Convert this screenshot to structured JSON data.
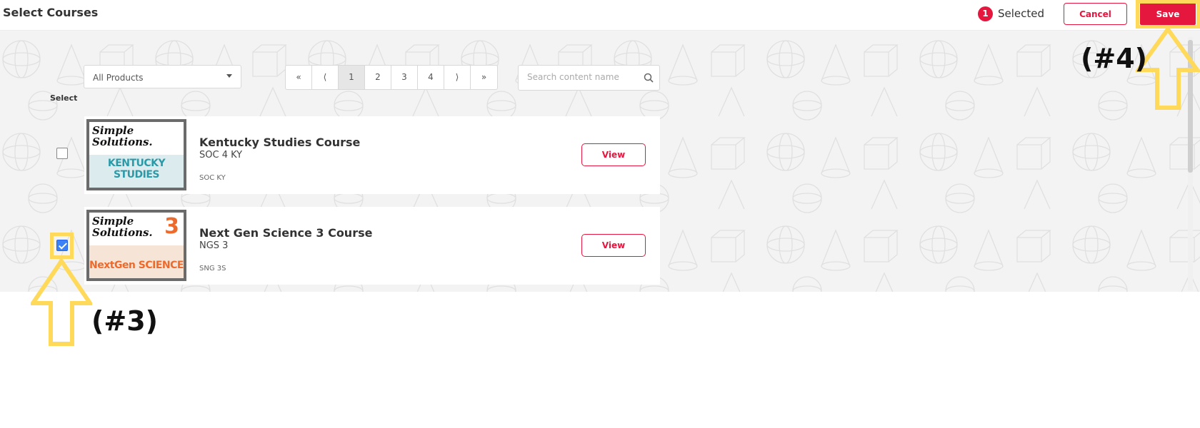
{
  "header": {
    "title": "Select Courses",
    "selected_count": "1",
    "selected_label": "Selected",
    "cancel_label": "Cancel",
    "save_label": "Save"
  },
  "filters": {
    "product_filter": "All Products",
    "pagination": [
      "«",
      "⟨",
      "1",
      "2",
      "3",
      "4",
      "⟩",
      "»"
    ],
    "current_page": "1",
    "search_placeholder": "Search content name"
  },
  "list": {
    "select_header": "Select",
    "courses": [
      {
        "title": "Kentucky Studies Course",
        "code": "SOC 4 KY",
        "subcode": "SOC KY",
        "view_label": "View",
        "checked": false,
        "thumb_brand": "Simple Solutions.",
        "thumb_title": "KENTUCKY STUDIES",
        "thumb_color": "#2a9aa8"
      },
      {
        "title": "Next Gen Science 3 Course",
        "code": "NGS 3",
        "subcode": "SNG 3S",
        "view_label": "View",
        "checked": true,
        "thumb_brand": "Simple Solutions.",
        "thumb_title": "NextGen SCIENCE",
        "thumb_grade": "3",
        "thumb_color": "#ec6b2c"
      }
    ]
  },
  "annotations": {
    "checkbox_marker": "(#3)",
    "save_marker": "(#4)"
  },
  "colors": {
    "accent": "#e5173f",
    "highlight": "#ffd95a",
    "checkbox": "#3b82f6"
  }
}
